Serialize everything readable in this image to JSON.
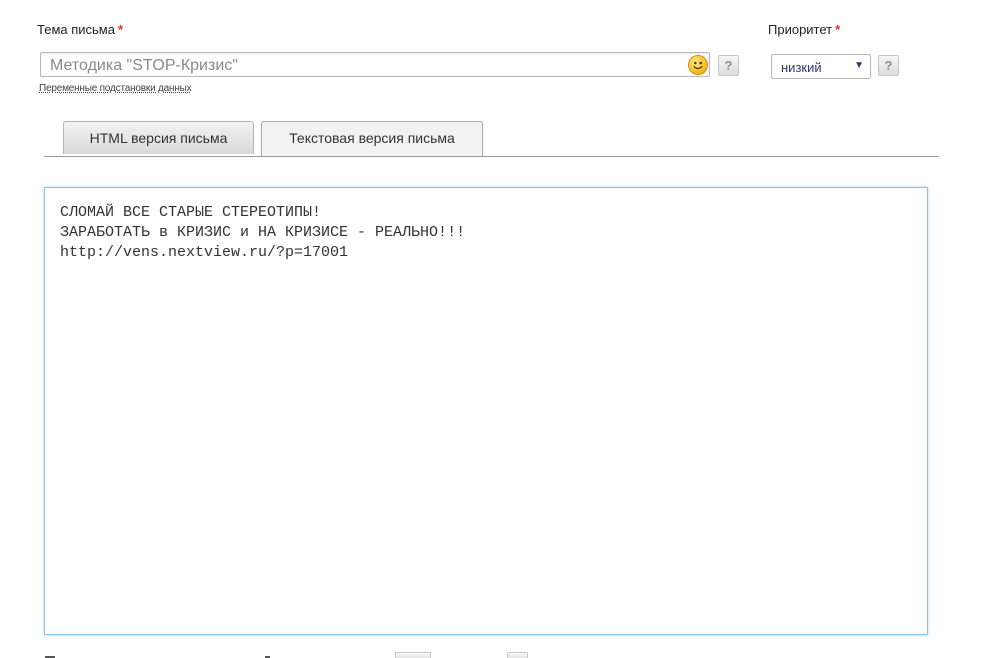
{
  "subject": {
    "label": "Тема письма",
    "required_mark": "*",
    "value": "Методика \"STOP-Кризис\"",
    "emoji_icon": "smiley-icon",
    "help_label": "?",
    "variables_link": "Переменные подстановки данных"
  },
  "priority": {
    "label": "Приоритет",
    "required_mark": "*",
    "selected": "низкий",
    "arrow": "▼",
    "help_label": "?"
  },
  "tabs": [
    {
      "label": "HTML версия письма",
      "active": false
    },
    {
      "label": "Текстовая версия письма",
      "active": true
    }
  ],
  "body_text": {
    "lines": [
      "СЛОМАЙ ВСЕ СТАРЫЕ СТЕРЕОТИПЫ!",
      "ЗАРАБОТАТЬ в КРИЗИС и НА КРИЗИСЕ - РЕАЛЬНО!!!",
      "http://vens.nextview.ru/?p=17001"
    ]
  },
  "colors": {
    "required": "#e0322b",
    "editor_border": "#8cc1ea",
    "select_text": "#2e3a78"
  }
}
